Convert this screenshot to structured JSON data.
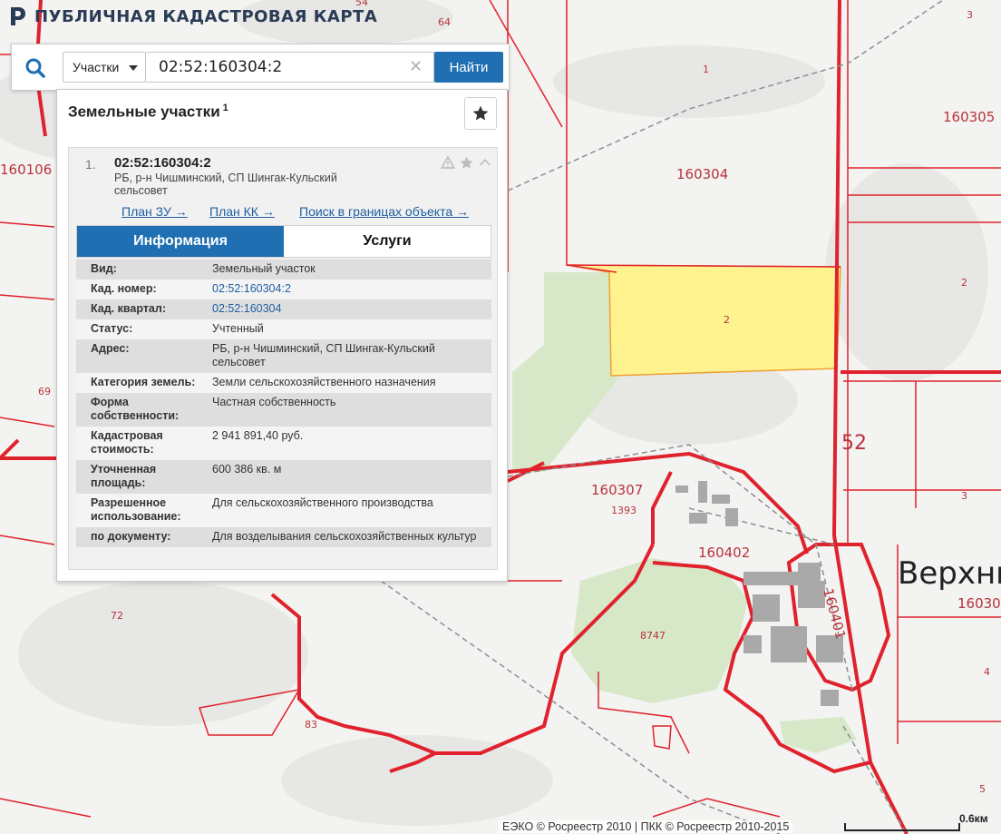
{
  "header": {
    "title": "ПУБЛИЧНАЯ КАДАСТРОВАЯ КАРТА",
    "logo_icon": "rosreestr-logo-icon"
  },
  "search": {
    "type_label": "Участки",
    "query": "02:52:160304:2",
    "button_label": "Найти",
    "clear_icon": "✕",
    "search_icon": "search-icon"
  },
  "results": {
    "title": "Земельные участки",
    "count": "1",
    "items": [
      {
        "num": "1.",
        "id": "02:52:160304:2",
        "address": "РБ, р-н Чишминский, СП Шингак-Кульский сельсовет",
        "links": {
          "plan_zu": "План ЗУ →",
          "plan_kk": "План КК →",
          "search_in": "Поиск в границах объекта →"
        },
        "tabs": {
          "info": "Информация",
          "services": "Услуги"
        },
        "info": [
          {
            "key": "Вид:",
            "value": "Земельный участок"
          },
          {
            "key": "Кад. номер:",
            "value": "02:52:160304:2"
          },
          {
            "key": "Кад. квартал:",
            "value": "02:52:160304"
          },
          {
            "key": "Статус:",
            "value": "Учтенный"
          },
          {
            "key": "Адрес:",
            "value": "РБ, р-н Чишминский, СП Шингак-Кульский сельсовет"
          },
          {
            "key": "Категория земель:",
            "value": "Земли сельскохозяйственного назначения"
          },
          {
            "key": "Форма собственности:",
            "value": "Частная собственность"
          },
          {
            "key": "Кадастровая стоимость:",
            "value": "2 941 891,40 руб."
          },
          {
            "key": "Уточненная площадь:",
            "value": "600 386 кв. м"
          },
          {
            "key": "Разрешенное использование:",
            "value": "Для сельскохозяйственного производства"
          },
          {
            "key": "по документу:",
            "value": "Для возделывания сельскохозяйственных культур"
          }
        ]
      }
    ]
  },
  "map": {
    "labels": {
      "l54": "54",
      "l64": "64",
      "l3a": "3",
      "l1": "1",
      "l160305": "160305",
      "l160106": "160106",
      "l160304": "160304",
      "l2a": "2",
      "l2b": "2",
      "l69": "69",
      "l52": "52",
      "l160307": "160307",
      "l1393": "1393",
      "l3b": "3",
      "l160402": "160402",
      "l160401": "160401",
      "town": "Верхни",
      "l160301": "16030",
      "l72": "72",
      "l8747": "8747",
      "l4": "4",
      "l83": "83",
      "l5": "5"
    },
    "highlight_color": "#fff38f",
    "boundary_color": "#e0222d"
  },
  "footer": {
    "copyright": "ЕЭКО © Росреестр 2010 | ПКК © Росреестр 2010-2015",
    "scale": "0.6км"
  }
}
